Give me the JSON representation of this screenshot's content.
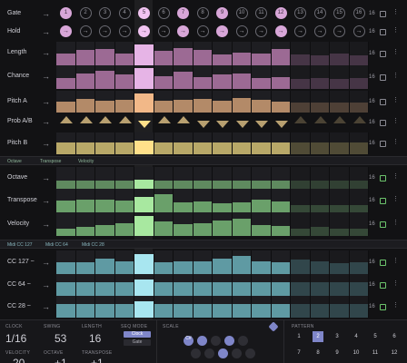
{
  "colors": {
    "background": "#121214",
    "gate_on": "#d8a6d8",
    "length": "#9c6a94",
    "chance": "#9c6a94",
    "pitch_a": "#b38a68",
    "prob_ab": "#b8a070",
    "pitch_b": "#b8a868",
    "octave": "#5f8a5f",
    "transpose": "#6aa06a",
    "velocity": "#6aa06a",
    "cc": "#5f9aa3",
    "highlight_length": "#e6b4e6",
    "highlight_pitch": "#f2b888",
    "highlight_pitchb": "#ffe08a",
    "highlight_green": "#a8e8a0",
    "highlight_cc": "#a8e6f0",
    "scale_accent": "#7f86c9"
  },
  "gate": {
    "label": "Gate",
    "steps": [
      "1",
      "2",
      "3",
      "4",
      "5",
      "6",
      "7",
      "8",
      "9",
      "10",
      "11",
      "12",
      "13",
      "14",
      "15",
      "16"
    ],
    "active": [
      true,
      false,
      false,
      false,
      true,
      false,
      true,
      false,
      true,
      false,
      false,
      true,
      false,
      false,
      false,
      false
    ],
    "length": "16"
  },
  "hold": {
    "label": "Hold",
    "glyph": "→",
    "active": [
      true,
      false,
      false,
      false,
      true,
      false,
      true,
      false,
      true,
      false,
      false,
      true,
      false,
      false,
      false,
      false
    ],
    "length": "16"
  },
  "rows": {
    "length": {
      "label": "Length",
      "length": "16",
      "values": [
        0.55,
        0.7,
        0.75,
        0.55,
        0.95,
        0.65,
        0.8,
        0.7,
        0.5,
        0.6,
        0.55,
        0.75,
        0.5,
        0.45,
        0.55,
        0.45
      ]
    },
    "chance": {
      "label": "Chance",
      "length": "16",
      "values": [
        0.5,
        0.7,
        0.85,
        0.65,
        0.95,
        0.6,
        0.8,
        0.55,
        0.65,
        0.7,
        0.5,
        0.55,
        0.45,
        0.5,
        0.45,
        0.5
      ]
    },
    "pitch_a": {
      "label": "Pitch A",
      "length": "16",
      "values": [
        0.55,
        0.7,
        0.6,
        0.65,
        0.95,
        0.6,
        0.65,
        0.7,
        0.6,
        0.75,
        0.65,
        0.55,
        0.5,
        0.5,
        0.5,
        0.5
      ]
    },
    "pitch_b": {
      "label": "Pitch B",
      "length": "16",
      "values": [
        0.6,
        0.6,
        0.6,
        0.6,
        0.7,
        0.6,
        0.6,
        0.6,
        0.6,
        0.6,
        0.6,
        0.6,
        0.6,
        0.6,
        0.6,
        0.6
      ]
    },
    "octave": {
      "label": "Octave",
      "length": "16",
      "values": [
        0.4,
        0.4,
        0.4,
        0.4,
        0.45,
        0.4,
        0.4,
        0.4,
        0.4,
        0.4,
        0.4,
        0.4,
        0.4,
        0.4,
        0.4,
        0.4
      ]
    },
    "transpose": {
      "label": "Transpose",
      "length": "16",
      "values": [
        0.55,
        0.6,
        0.6,
        0.55,
        0.7,
        0.85,
        0.45,
        0.5,
        0.4,
        0.45,
        0.6,
        0.5,
        0.35,
        0.35,
        0.35,
        0.35
      ]
    },
    "velocity": {
      "label": "Velocity",
      "length": "16",
      "values": [
        0.35,
        0.4,
        0.5,
        0.6,
        0.9,
        0.65,
        0.55,
        0.6,
        0.7,
        0.8,
        0.5,
        0.45,
        0.35,
        0.4,
        0.35,
        0.35
      ]
    },
    "cc127": {
      "label": "CC 127 ~",
      "length": "16",
      "values": [
        0.55,
        0.55,
        0.7,
        0.6,
        0.9,
        0.55,
        0.6,
        0.6,
        0.7,
        0.85,
        0.6,
        0.55,
        0.65,
        0.6,
        0.5,
        0.55
      ]
    },
    "cc64": {
      "label": "CC 64 ~",
      "length": "16",
      "values": [
        0.7,
        0.7,
        0.7,
        0.7,
        0.8,
        0.7,
        0.7,
        0.7,
        0.7,
        0.7,
        0.7,
        0.7,
        0.7,
        0.7,
        0.7,
        0.7
      ]
    },
    "cc28": {
      "label": "CC 28 ~",
      "length": "16",
      "values": [
        0.7,
        0.7,
        0.7,
        0.7,
        0.8,
        0.7,
        0.7,
        0.7,
        0.7,
        0.7,
        0.7,
        0.7,
        0.7,
        0.7,
        0.7,
        0.7
      ]
    }
  },
  "prob_ab": {
    "label": "Prob A/B",
    "length": "16",
    "up": [
      true,
      true,
      true,
      true,
      false,
      true,
      true,
      false,
      false,
      false,
      false,
      false,
      true,
      true,
      true,
      true
    ]
  },
  "sections": {
    "note_tags": [
      "Octave",
      "Transpose",
      "Velocity"
    ],
    "cc_tags": [
      "Midi CC 127",
      "Midi CC 64",
      "Midi CC 28"
    ]
  },
  "bottom": {
    "clock_label": "CLOCK",
    "clock_value": "1/16",
    "swing_label": "SWING",
    "swing_value": "53",
    "length_label": "LENGTH",
    "length_value": "16",
    "seqmode_label": "SEQ MODE",
    "seqmode_options": [
      "Clock",
      "Gate"
    ],
    "velocity_label": "VELOCITY",
    "velocity_value": "20",
    "octave_label": "OCTAVE",
    "octave_value": "+1",
    "transpose_label": "TRANSPOSE",
    "transpose_value": "+1",
    "scale_label": "SCALE",
    "scale_root": "C#",
    "pattern_label": "PATTERN",
    "patterns": [
      "1",
      "2",
      "3",
      "4",
      "5",
      "6",
      "7",
      "8",
      "9",
      "10",
      "11",
      "12"
    ],
    "pattern_selected": "2"
  }
}
